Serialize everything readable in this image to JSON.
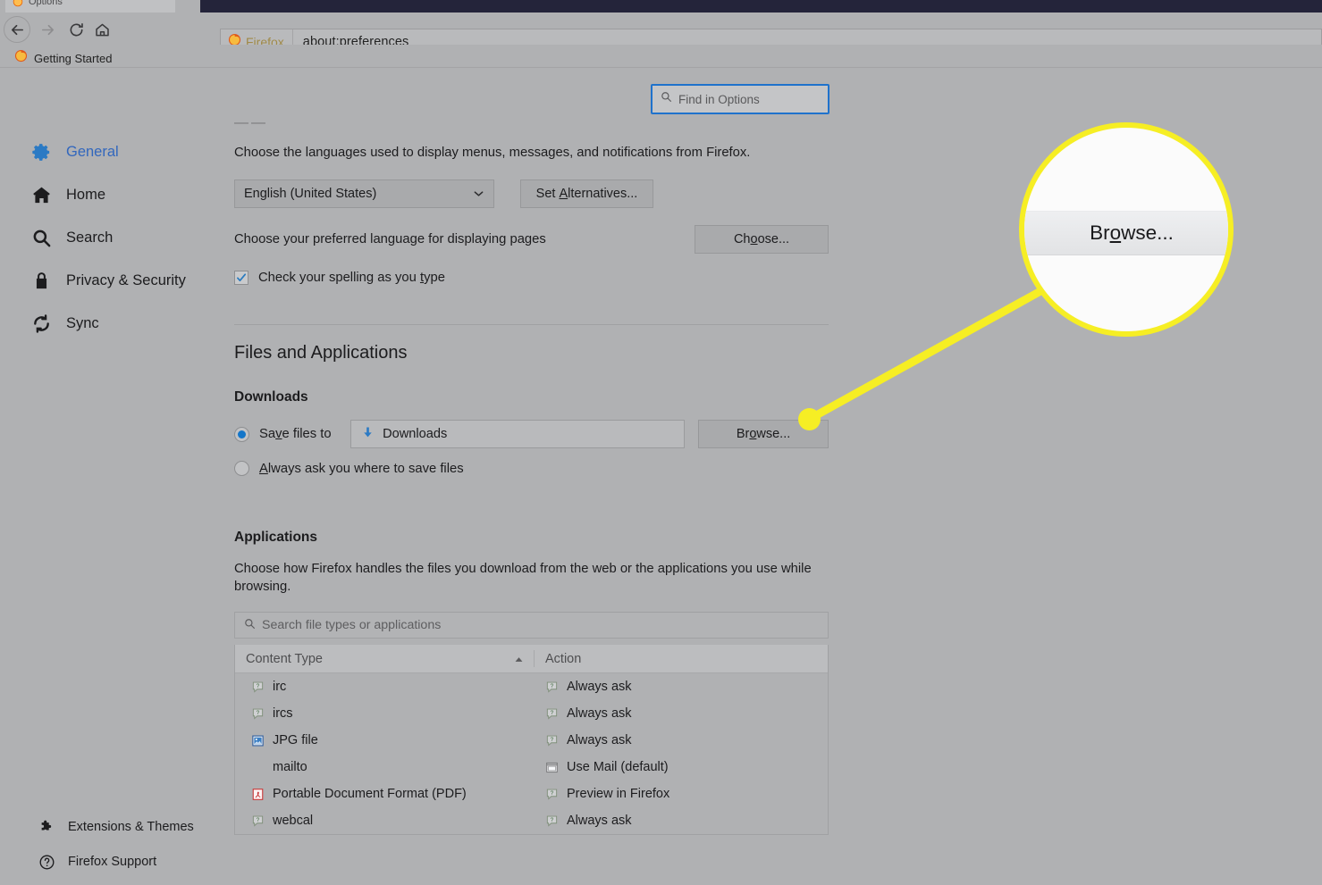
{
  "window": {
    "tab_title": "Options",
    "tab_favicon": "firefox-icon"
  },
  "toolbar": {
    "back_icon": "back-arrow-icon",
    "forward_icon": "forward-arrow-icon",
    "reload_icon": "reload-icon",
    "home_icon": "home-icon",
    "url_badge": "Firefox",
    "url_badge_icon": "firefox-icon",
    "url_value": "about:preferences"
  },
  "bookmarks": {
    "items": [
      {
        "label": "Getting Started",
        "icon": "firefox-icon"
      }
    ]
  },
  "sidebar": {
    "items": [
      {
        "label": "General",
        "icon": "gear-icon",
        "selected": true
      },
      {
        "label": "Home",
        "icon": "home-icon",
        "selected": false
      },
      {
        "label": "Search",
        "icon": "search-icon",
        "selected": false
      },
      {
        "label": "Privacy & Security",
        "icon": "lock-icon",
        "selected": false
      },
      {
        "label": "Sync",
        "icon": "sync-icon",
        "selected": false
      }
    ],
    "bottom_items": [
      {
        "label": "Extensions & Themes",
        "icon": "puzzle-piece-icon"
      },
      {
        "label": "Firefox Support",
        "icon": "question-circle-icon"
      }
    ]
  },
  "search": {
    "placeholder": "Find in Options",
    "icon": "search-icon",
    "focus_color": "#1f72cc"
  },
  "language": {
    "cut_heading": "Language",
    "description": "Choose the languages used to display menus, messages, and notifications from Firefox.",
    "selected_language": "English (United States)",
    "dropdown_icon": "chevron-down-icon",
    "set_alternatives_label": "Set Alternatives...",
    "set_alternatives_accel": "A",
    "preferred_label": "Choose your preferred language for displaying pages",
    "choose_label": "Choose...",
    "choose_accel": "o",
    "spellcheck_label": "Check your spelling as you type",
    "spellcheck_accel": "t",
    "spellcheck_checked": true,
    "check_color": "#2a7bbf"
  },
  "files_and_applications": {
    "section_title": "Files and Applications",
    "downloads": {
      "title": "Downloads",
      "save_files_label": "Save files to",
      "save_files_accel": "v",
      "save_files_selected": true,
      "path_value": "Downloads",
      "path_icon": "download-arrow-icon",
      "browse_label": "Browse...",
      "browse_accel": "o",
      "always_ask_label": "Always ask you where to save files",
      "always_ask_accel": "A",
      "always_ask_selected": false,
      "radio_color": "#1476c9"
    },
    "applications": {
      "title": "Applications",
      "description": "Choose how Firefox handles the files you download from the web or the applications you use while browsing.",
      "search_placeholder": "Search file types or applications",
      "search_icon": "search-icon",
      "columns": [
        {
          "label": "Content Type",
          "sort_icon": "sort-ascending-icon",
          "sorted": true
        },
        {
          "label": "Action",
          "sort_icon": "",
          "sorted": false
        }
      ],
      "rows": [
        {
          "type": "irc",
          "type_icon": "unknown-doc-icon",
          "action": "Always ask",
          "action_icon": "unknown-doc-icon"
        },
        {
          "type": "ircs",
          "type_icon": "unknown-doc-icon",
          "action": "Always ask",
          "action_icon": "unknown-doc-icon"
        },
        {
          "type": "JPG file",
          "type_icon": "image-file-icon",
          "action": "Always ask",
          "action_icon": "unknown-doc-icon"
        },
        {
          "type": "mailto",
          "type_icon": "",
          "action": "Use Mail (default)",
          "action_icon": "mail-app-icon"
        },
        {
          "type": "Portable Document Format (PDF)",
          "type_icon": "pdf-file-icon",
          "action": "Preview in Firefox",
          "action_icon": "unknown-doc-icon"
        },
        {
          "type": "webcal",
          "type_icon": "unknown-doc-icon",
          "action": "Always ask",
          "action_icon": "unknown-doc-icon"
        }
      ]
    }
  },
  "callout": {
    "magnified_label": "Browse...",
    "magnified_accel": "o",
    "highlight_color": "#f6ee24"
  }
}
